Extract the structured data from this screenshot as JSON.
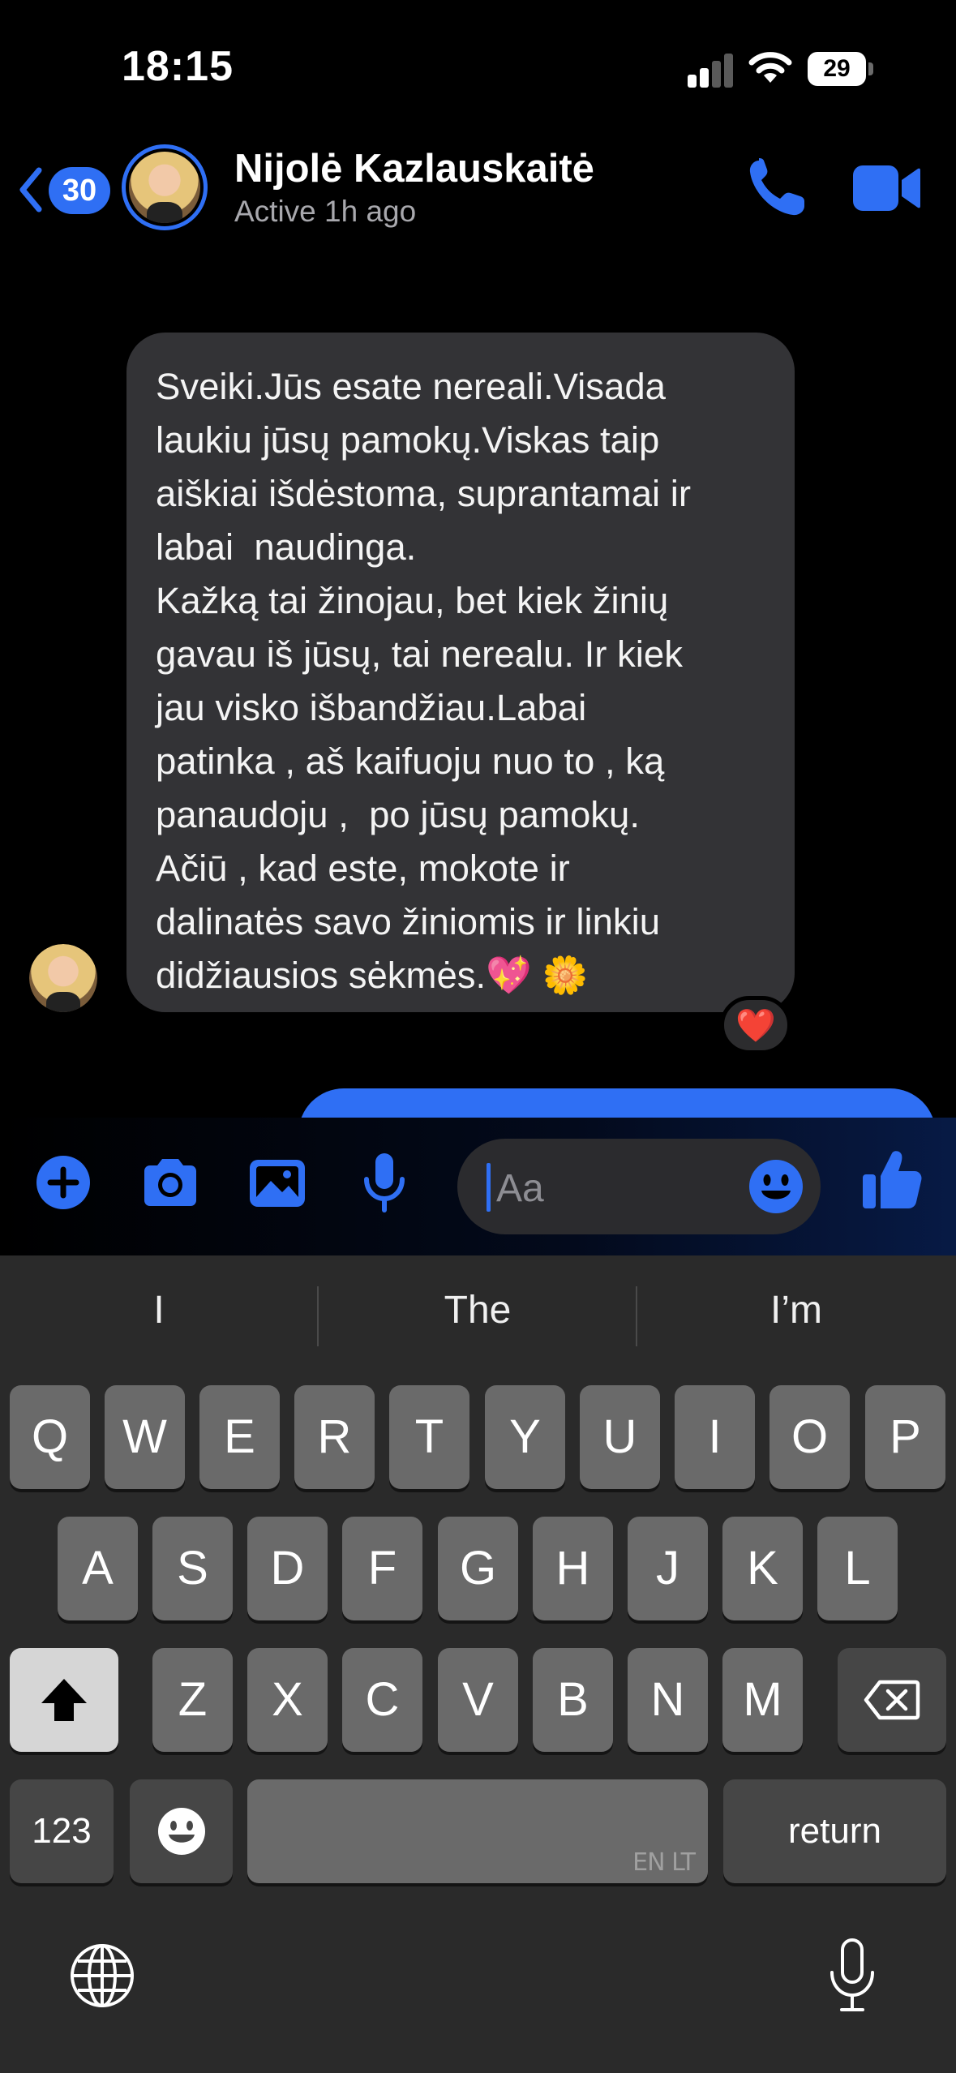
{
  "status_bar": {
    "time": "18:15",
    "battery": "29"
  },
  "header": {
    "back_count": "30",
    "contact_name": "Nijolė Kazlauskaitė",
    "contact_status": "Active 1h ago"
  },
  "message": {
    "text": "Sveiki.Jūs esate nereali.Visada\nlaukiu jūsų pamokų.Viskas taip\naiškiai išdėstoma, suprantamai ir\nlabai  naudinga.\nKažką tai žinojau, bet kiek žinių\ngavau iš jūsų, tai nerealu. Ir kiek\njau visko išbandžiau.Labai\npatinka , aš kaifuoju nuo to , ką\npanaudoju ,  po jūsų pamokų.\nAčiū , kad este, mokote ir\ndalinatės savo žiniomis ir linkiu\ndidžiausios sėkmės.💖 🌼",
    "reaction": "❤️"
  },
  "composer": {
    "placeholder": "Aa"
  },
  "keyboard": {
    "suggestions": [
      "I",
      "The",
      "I’m"
    ],
    "row1": [
      "Q",
      "W",
      "E",
      "R",
      "T",
      "Y",
      "U",
      "I",
      "O",
      "P"
    ],
    "row2": [
      "A",
      "S",
      "D",
      "F",
      "G",
      "H",
      "J",
      "K",
      "L"
    ],
    "row3": [
      "Z",
      "X",
      "C",
      "V",
      "B",
      "N",
      "M"
    ],
    "numbers_key": "123",
    "space_language": "EN LT",
    "return_key": "return"
  },
  "colors": {
    "accent": "#2f6ff4",
    "bubble_incoming": "#333336",
    "keyboard_bg": "#2a2a2a"
  }
}
